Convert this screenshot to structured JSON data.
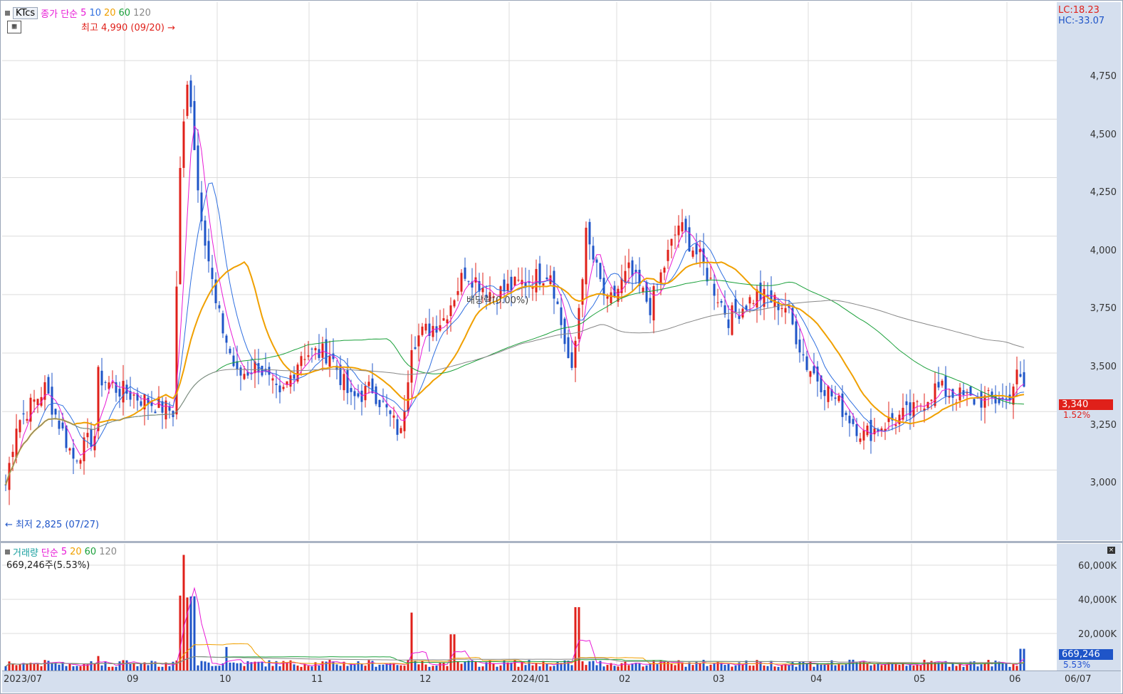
{
  "price_legend": {
    "ticker": "KTcs",
    "prefix": "종가 단순",
    "ma": [
      "5",
      "10",
      "20",
      "60",
      "120"
    ]
  },
  "volume_legend": {
    "title": "거래량",
    "prefix": "단순",
    "ma": [
      "5",
      "20",
      "60",
      "120"
    ],
    "summary": "669,246주(5.53%)"
  },
  "annotations": {
    "high": "최고 4,990 (09/20)",
    "low": "최저 2,825 (07/27)",
    "dividend": "배당락(0.00%)"
  },
  "price_axis": {
    "lc": "LC:18.23",
    "hc": "HC:-33.07",
    "ticks": [
      "4,750",
      "4,500",
      "4,250",
      "4,000",
      "3,750",
      "3,500",
      "3,250",
      "3,000"
    ],
    "last_price": "3,340",
    "last_change": "1.52%"
  },
  "volume_axis": {
    "ticks": [
      "60,000K",
      "40,000K",
      "20,000K"
    ],
    "last_volume": "669,246",
    "last_pct": "5.53%"
  },
  "date_axis": [
    "2023/07",
    "09",
    "10",
    "11",
    "12",
    "2024/01",
    "02",
    "03",
    "04",
    "05",
    "06",
    "06/07"
  ],
  "colors": {
    "up": "#e0201a",
    "down": "#1f55c8",
    "ma5": "#e81ad6",
    "ma10": "#2f6fe0",
    "ma20": "#f0a000",
    "ma60": "#1aa03a",
    "ma120": "#888888",
    "axis_bg": "#d5dfee"
  },
  "chart_data": {
    "type": "candlestick",
    "price_range": [
      2825,
      4990
    ],
    "volume_range": [
      0,
      65000
    ],
    "volume_unit": "K shares",
    "ohlc_sample": [
      {
        "date": "2023/07",
        "close": 3100
      },
      {
        "date": "09",
        "close": 3350
      },
      {
        "date": "09/20",
        "close": 4600
      },
      {
        "date": "10",
        "close": 3450
      },
      {
        "date": "11",
        "close": 3400
      },
      {
        "date": "12",
        "close": 3650
      },
      {
        "date": "2024/01",
        "close": 3780
      },
      {
        "date": "02",
        "close": 3800
      },
      {
        "date": "03",
        "close": 3700
      },
      {
        "date": "04",
        "close": 3250
      },
      {
        "date": "05",
        "close": 3280
      },
      {
        "date": "06",
        "close": 3300
      },
      {
        "date": "06/07",
        "close": 3340
      }
    ]
  }
}
